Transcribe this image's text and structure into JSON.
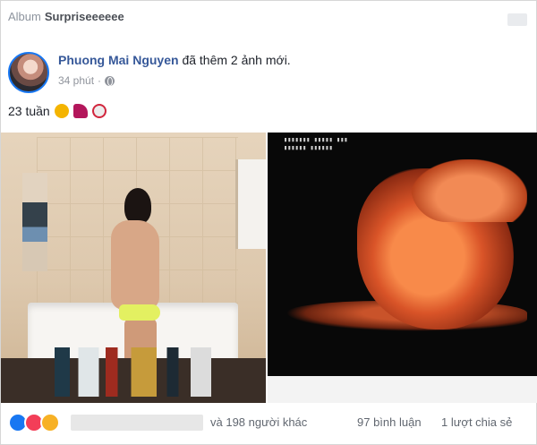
{
  "album": {
    "prefix": "Album",
    "name": "Surpriseeeeee"
  },
  "post": {
    "author": "Phuong Mai Nguyen",
    "action": "đã thêm 2 ảnh mới.",
    "time": "34 phút",
    "time_separator": "·",
    "caption": "23 tuần",
    "caption_emojis": [
      "cat-face-emoji",
      "high-heel-emoji",
      "clown-emoji"
    ],
    "privacy_icon": "globe-icon"
  },
  "stats": {
    "reaction_icons": [
      "like-icon",
      "love-icon",
      "wow-icon"
    ],
    "others": "và 198 người khác",
    "comments": "97 bình luận",
    "shares": "1 lượt chia sẻ"
  },
  "colors": {
    "author_link": "#365899",
    "meta_text": "#90949c",
    "like": "#1877f2",
    "love": "#f33e58",
    "wow": "#f7b125"
  }
}
